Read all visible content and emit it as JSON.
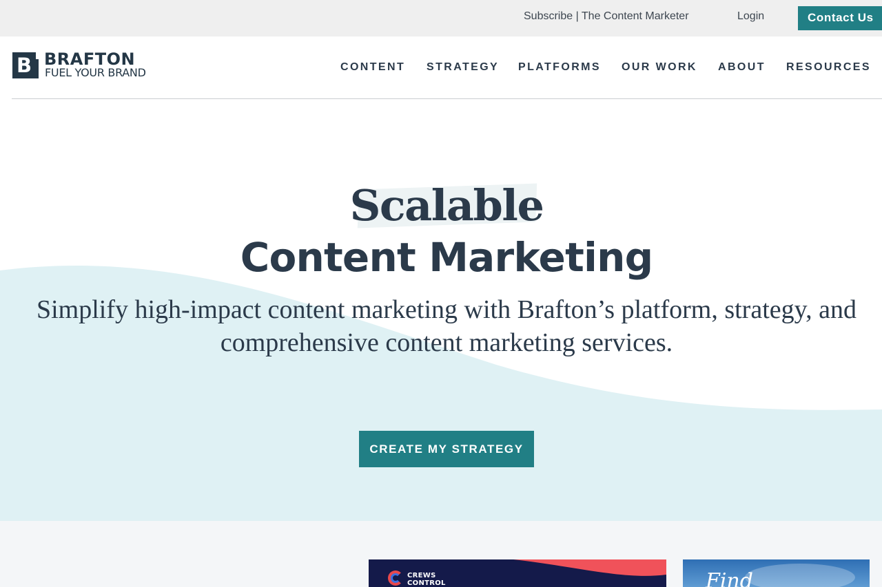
{
  "utility_bar": {
    "subscribe_label": "Subscribe | The Content Marketer",
    "login_label": "Login",
    "contact_label": "Contact Us"
  },
  "header": {
    "logo_letter": "B",
    "logo_name": "BRAFTON",
    "logo_tagline": "FUEL YOUR BRAND",
    "nav": {
      "content": "CONTENT",
      "strategy": "STRATEGY",
      "platforms": "PLATFORMS",
      "our_work": "OUR WORK",
      "about": "ABOUT",
      "resources": "RESOURCES"
    }
  },
  "hero": {
    "kicker": "Scalable",
    "title": "Content Marketing",
    "subtitle": "Simplify high-impact content marketing with Brafton’s platform, strategy, and comprehensive content marketing services.",
    "cta_label": "CREATE MY STRATEGY"
  },
  "cards": {
    "crews_control_logo_text": "CREWS\nCONTROL",
    "find_text": "Find"
  },
  "colors": {
    "accent": "#217f85",
    "navy": "#243746",
    "text": "#2b3a4a",
    "wave": "#dff1f4",
    "utility_bg": "#efefef",
    "lower_bg": "#f4f6f8"
  },
  "icons": {
    "logo": "brafton-b-logo-icon",
    "crews_logo": "crews-control-c-logo-icon"
  }
}
